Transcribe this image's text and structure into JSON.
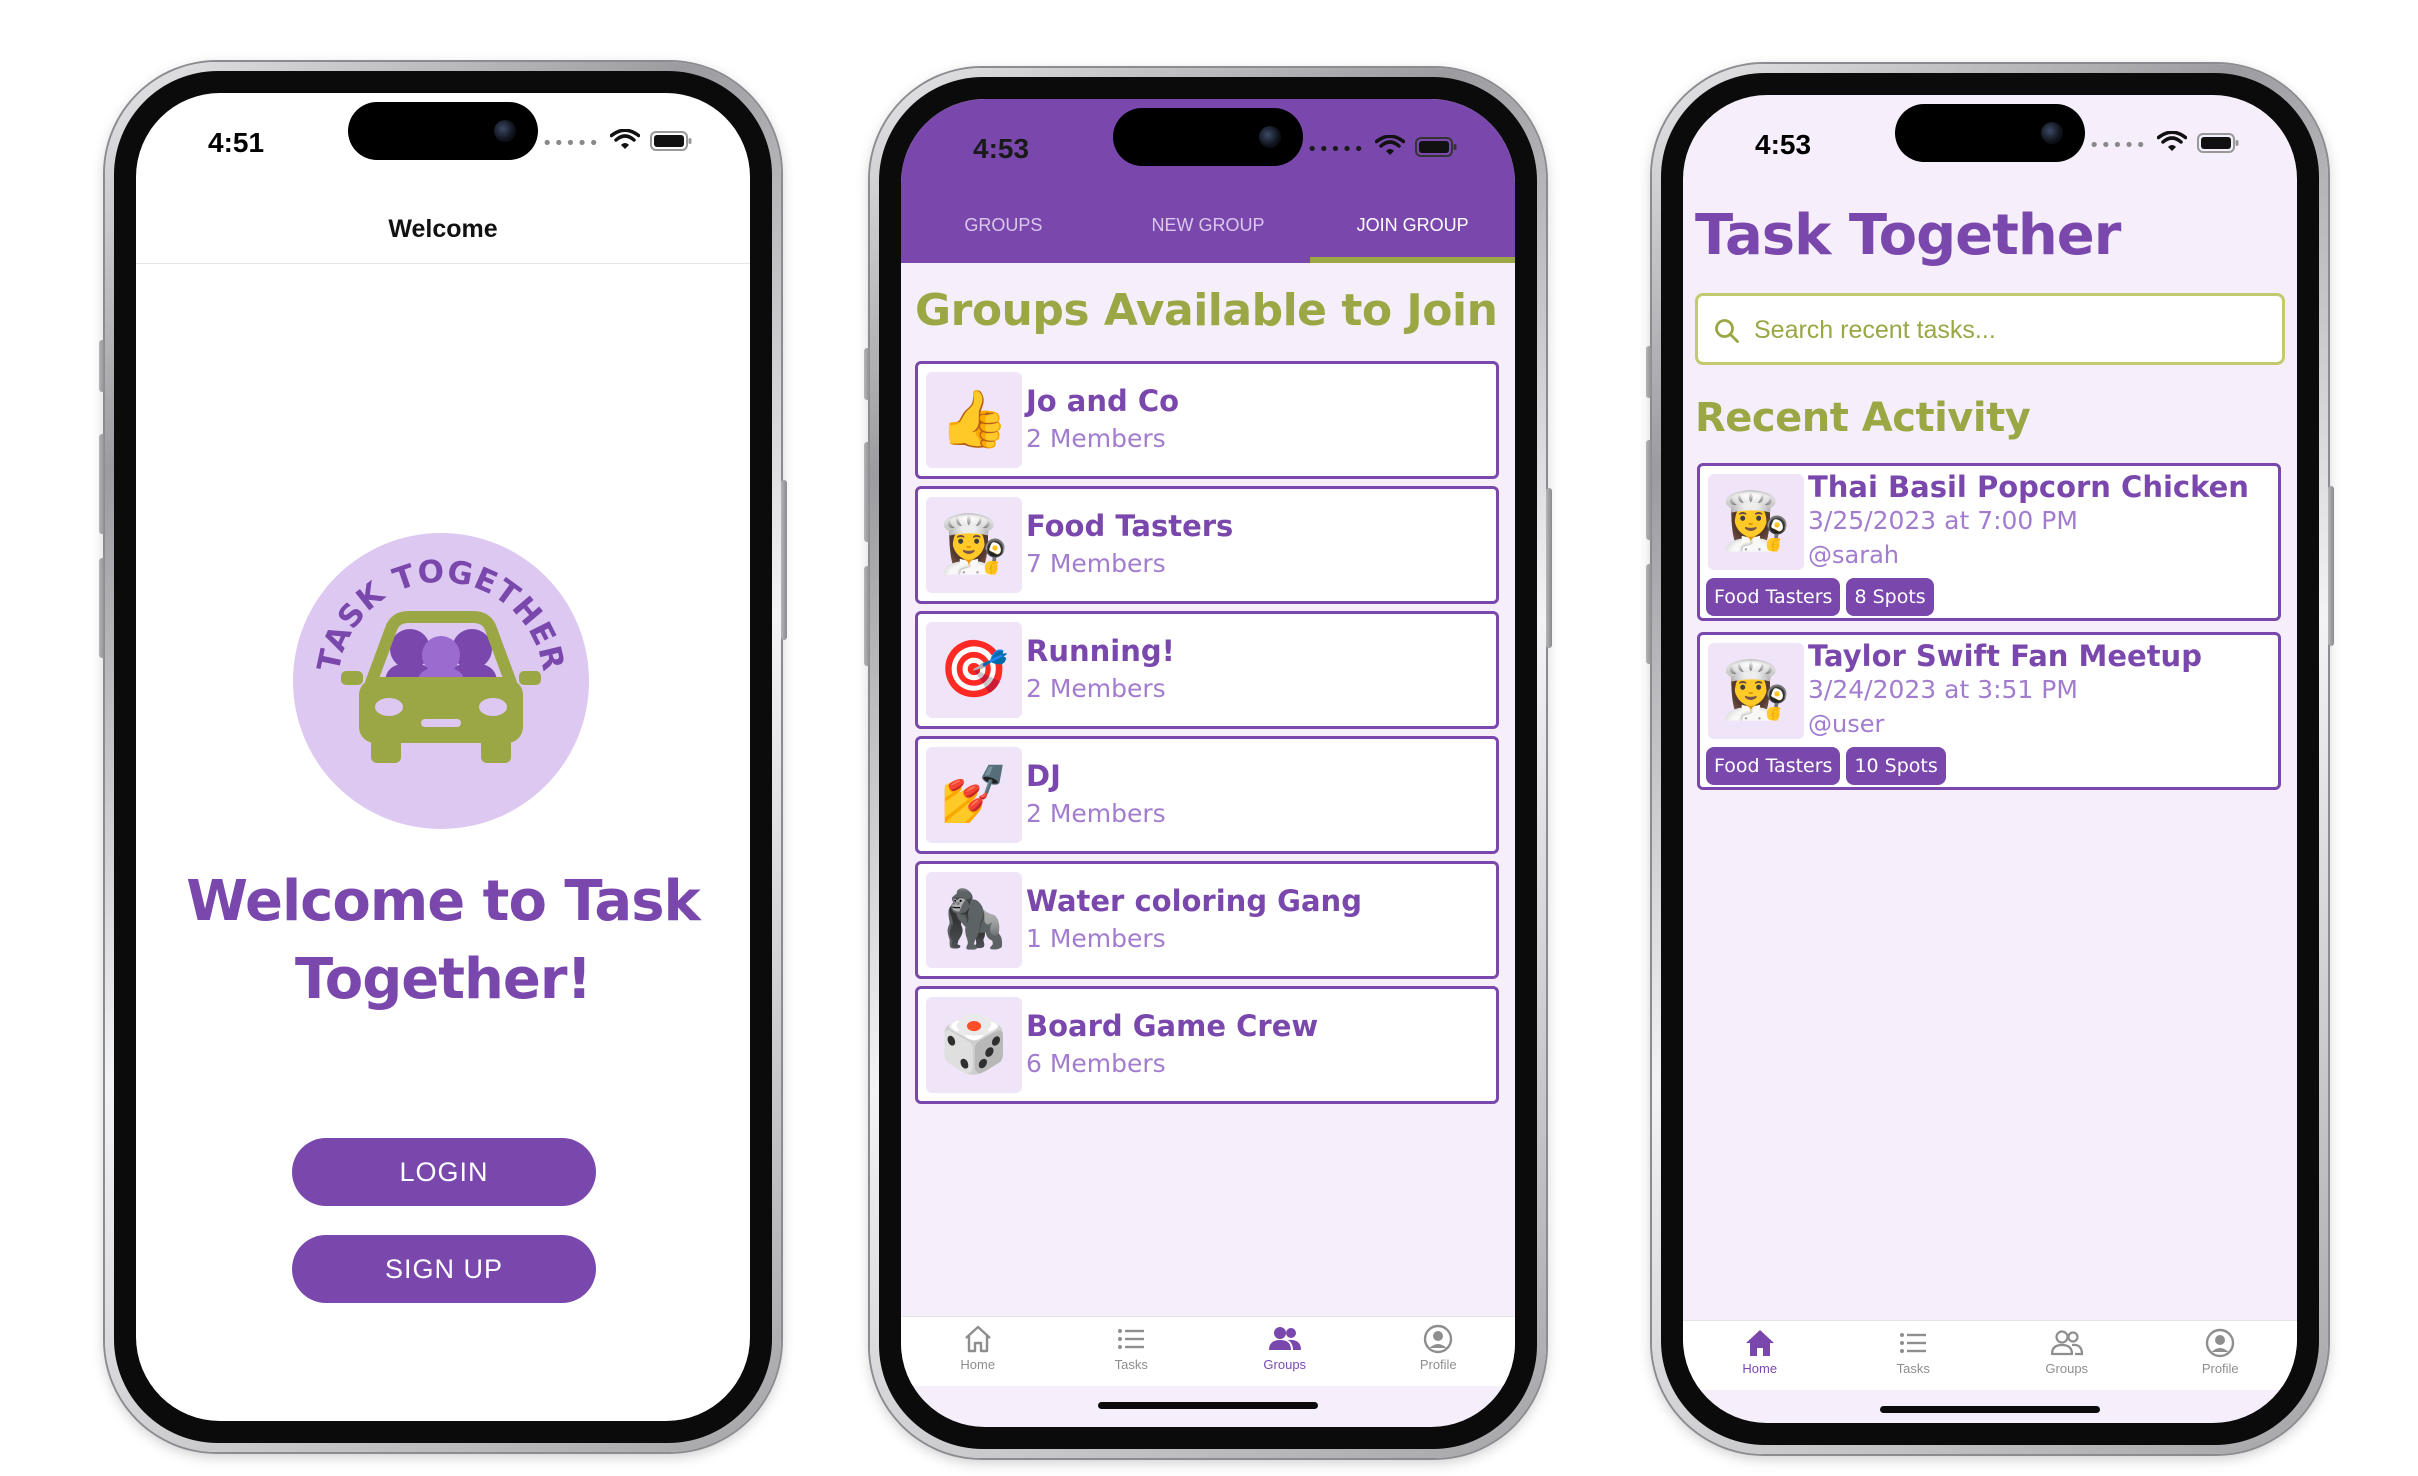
{
  "colors": {
    "primary_purple": "#7a48ad",
    "accent_olive": "#9aa744",
    "light_lavender": "#f6effb",
    "muted_purple": "#a27cce"
  },
  "phone1": {
    "status_time": "4:51",
    "nav_title": "Welcome",
    "logo_text": "TASK TOGETHER",
    "heading_line1": "Welcome to Task",
    "heading_line2": "Together!",
    "login_label": "LOGIN",
    "signup_label": "SIGN UP"
  },
  "phone2": {
    "status_time": "4:53",
    "tabs": [
      {
        "label": "GROUPS"
      },
      {
        "label": "NEW GROUP"
      },
      {
        "label": "JOIN GROUP"
      }
    ],
    "section_title": "Groups Available to Join",
    "groups": [
      {
        "emoji": "👍",
        "name": "Jo and Co",
        "members": "2 Members"
      },
      {
        "emoji": "👩‍🍳",
        "name": "Food Tasters",
        "members": "7 Members"
      },
      {
        "emoji": "🎯",
        "name": "Running!",
        "members": "2 Members"
      },
      {
        "emoji": "💅",
        "name": "DJ",
        "members": "2 Members"
      },
      {
        "emoji": "🦍",
        "name": "Water coloring Gang",
        "members": "1 Members"
      },
      {
        "emoji": "🎲",
        "name": "Board Game Crew",
        "members": "6 Members"
      }
    ],
    "bottom_tabs": [
      {
        "label": "Home",
        "icon": "house-icon"
      },
      {
        "label": "Tasks",
        "icon": "list-icon"
      },
      {
        "label": "Groups",
        "icon": "people-icon"
      },
      {
        "label": "Profile",
        "icon": "person-circle-icon"
      }
    ]
  },
  "phone3": {
    "status_time": "4:53",
    "app_title": "Task Together",
    "search_placeholder": "Search recent tasks...",
    "section_title": "Recent Activity",
    "activities": [
      {
        "emoji": "👩‍🍳",
        "title": "Thai Basil Popcorn Chicken",
        "date": "3/25/2023 at 7:00 PM",
        "user": "@sarah",
        "group_tag": "Food Tasters",
        "spots_tag": "8 Spots"
      },
      {
        "emoji": "👩‍🍳",
        "title": "Taylor Swift Fan Meetup",
        "date": "3/24/2023 at 3:51 PM",
        "user": "@user",
        "group_tag": "Food Tasters",
        "spots_tag": "10 Spots"
      }
    ],
    "bottom_tabs": [
      {
        "label": "Home",
        "icon": "house-icon"
      },
      {
        "label": "Tasks",
        "icon": "list-icon"
      },
      {
        "label": "Groups",
        "icon": "people-icon"
      },
      {
        "label": "Profile",
        "icon": "person-circle-icon"
      }
    ]
  }
}
